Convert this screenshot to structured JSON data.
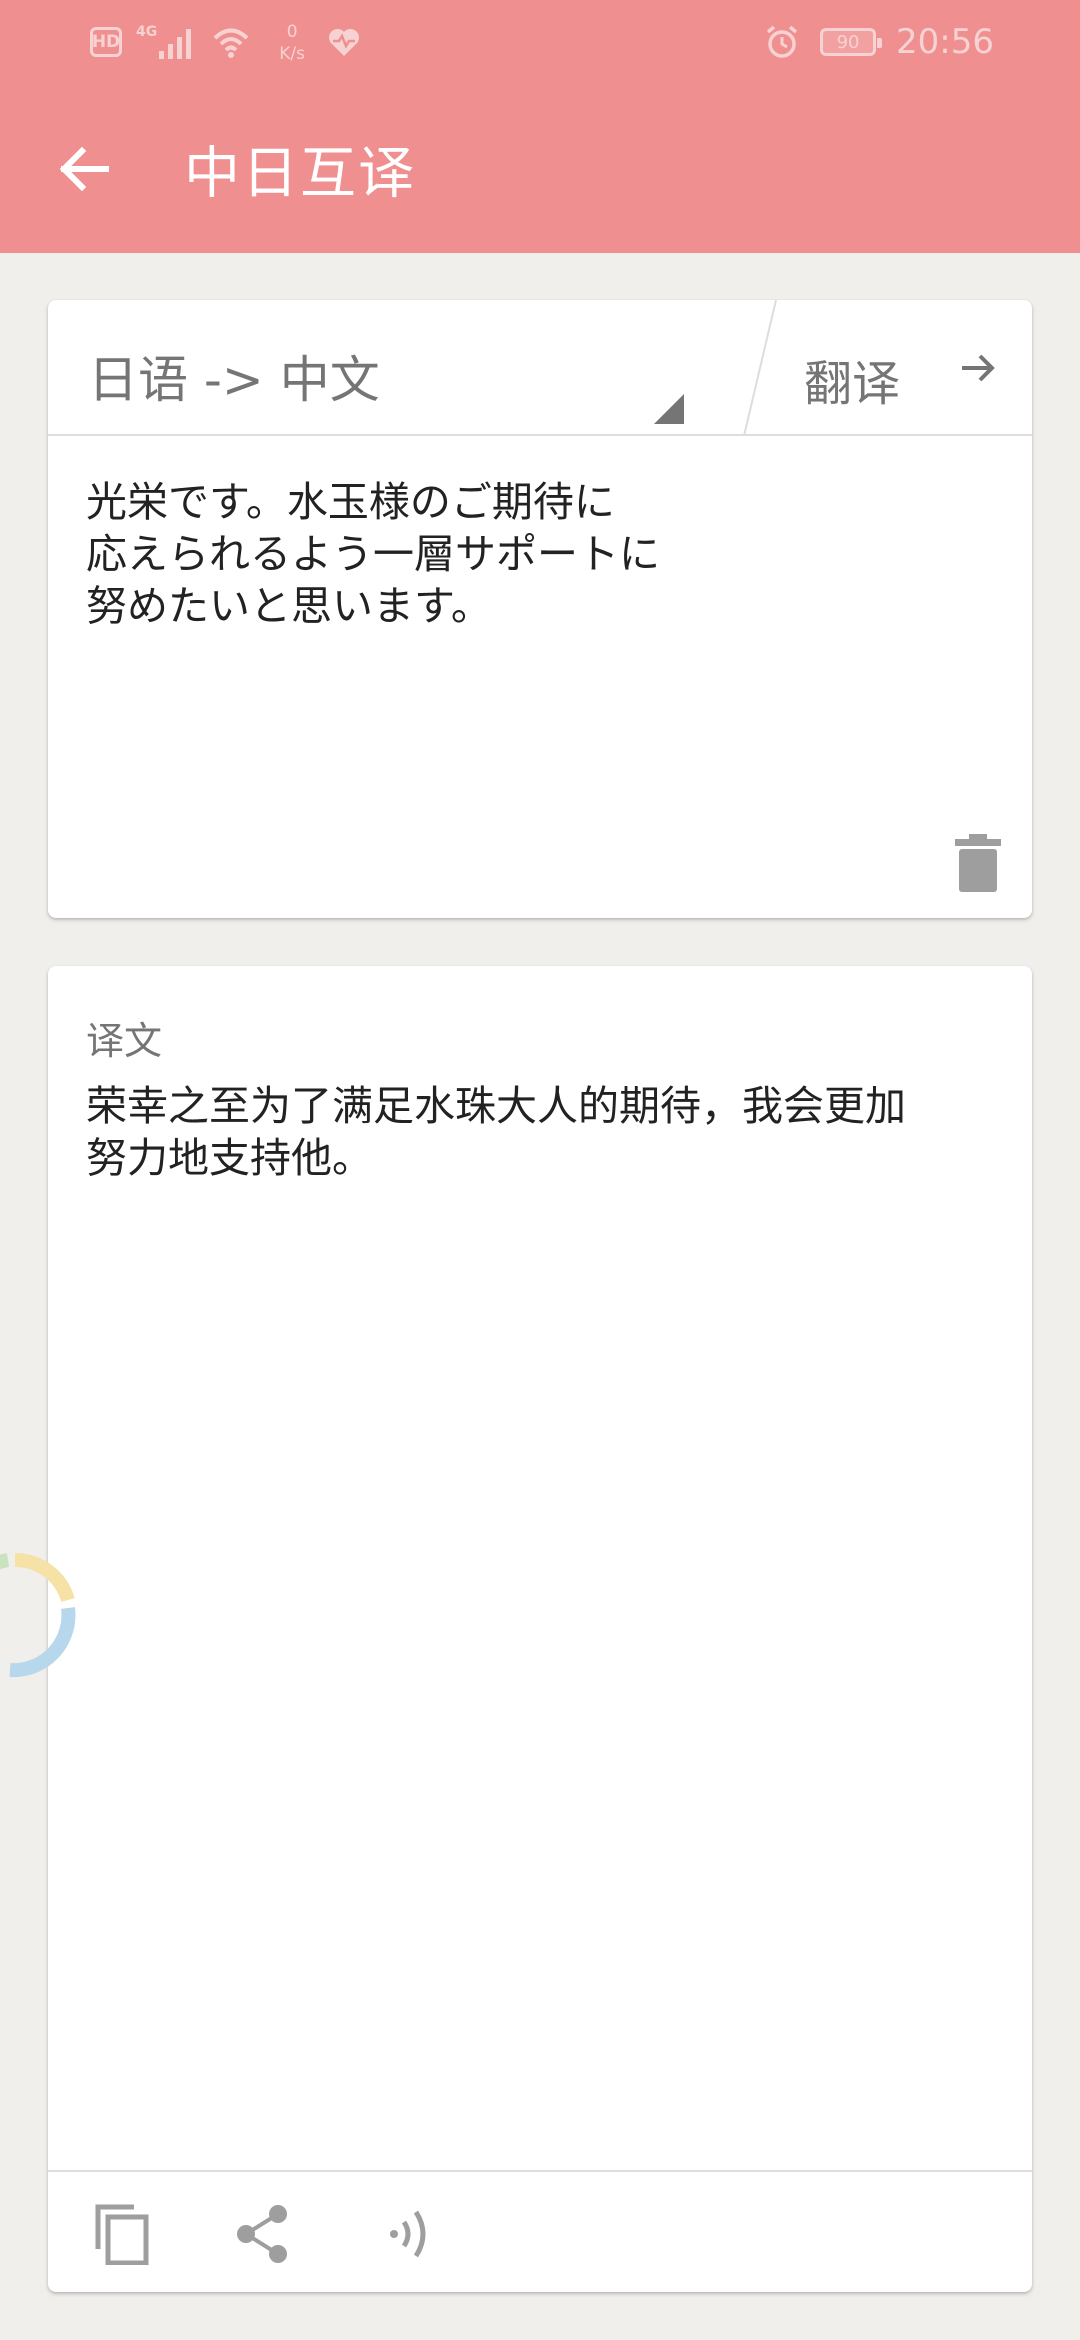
{
  "status_bar": {
    "hd_label": "HD",
    "network_type": "4G",
    "speed_value": "0",
    "speed_unit": "K/s",
    "battery_level": "90",
    "time": "20:56",
    "icons": [
      "hd-icon",
      "signal-icon",
      "wifi-icon",
      "health-heart-icon",
      "alarm-clock-icon",
      "battery-icon"
    ]
  },
  "app_bar": {
    "title": "中日互译",
    "back_icon": "arrow-left-icon"
  },
  "input_card": {
    "language_pair": "日语 -> 中文",
    "translate_label": "翻译",
    "translate_icon": "arrow-right-icon",
    "source_text": "光栄です。水玉様のご期待に\n応えられるよう一層サポートに\n努めたいと思います。",
    "delete_icon": "trash-icon"
  },
  "output_card": {
    "heading": "译文",
    "result_text": "荣幸之至为了满足水珠大人的期待，我会更加\n努力地支持他。",
    "actions": [
      "copy-icon",
      "share-icon",
      "speaker-icon"
    ]
  },
  "colors": {
    "primary": "#f08f8f",
    "background": "#f1efec",
    "card": "#ffffff",
    "secondary_text": "#757575",
    "body_text": "#222222"
  }
}
